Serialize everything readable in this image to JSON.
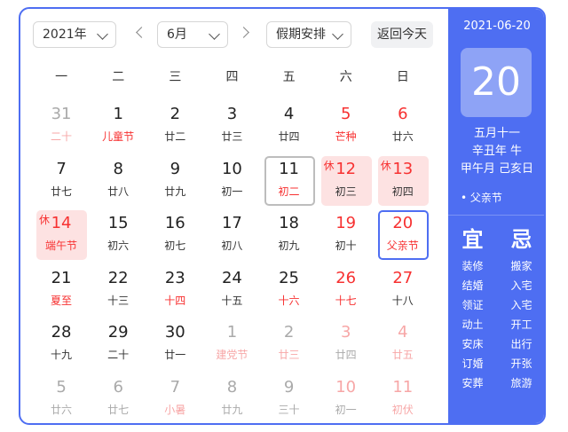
{
  "toolbar": {
    "year": "2021年",
    "month": "6月",
    "holiday_select": "假期安排",
    "today_button": "返回今天"
  },
  "weekdays": [
    "一",
    "二",
    "三",
    "四",
    "五",
    "六",
    "日"
  ],
  "days": [
    {
      "n": "31",
      "l": "二十",
      "other": true,
      "weekend": false,
      "redl": true
    },
    {
      "n": "1",
      "l": "儿童节",
      "redl": true
    },
    {
      "n": "2",
      "l": "廿二"
    },
    {
      "n": "3",
      "l": "廿三"
    },
    {
      "n": "4",
      "l": "廿四"
    },
    {
      "n": "5",
      "l": "芒种",
      "weekend": true,
      "redl": true
    },
    {
      "n": "6",
      "l": "廿六",
      "weekend": true
    },
    {
      "n": "7",
      "l": "廿七"
    },
    {
      "n": "8",
      "l": "廿八"
    },
    {
      "n": "9",
      "l": "廿九"
    },
    {
      "n": "10",
      "l": "初一"
    },
    {
      "n": "11",
      "l": "初二",
      "sel": true,
      "redl": true
    },
    {
      "n": "12",
      "l": "初三",
      "weekend": true,
      "holiday": true,
      "tag": "休"
    },
    {
      "n": "13",
      "l": "初四",
      "weekend": true,
      "holiday": true,
      "tag": "休"
    },
    {
      "n": "14",
      "l": "端午节",
      "holiday": true,
      "tag": "休",
      "redl": true,
      "weekend": true
    },
    {
      "n": "15",
      "l": "初六"
    },
    {
      "n": "16",
      "l": "初七"
    },
    {
      "n": "17",
      "l": "初八"
    },
    {
      "n": "18",
      "l": "初九"
    },
    {
      "n": "19",
      "l": "初十",
      "weekend": true
    },
    {
      "n": "20",
      "l": "父亲节",
      "weekend": true,
      "redl": true,
      "curr": true
    },
    {
      "n": "21",
      "l": "夏至",
      "redl": true
    },
    {
      "n": "22",
      "l": "十三"
    },
    {
      "n": "23",
      "l": "十四",
      "redl": true
    },
    {
      "n": "24",
      "l": "十五"
    },
    {
      "n": "25",
      "l": "十六",
      "redl": true
    },
    {
      "n": "26",
      "l": "十七",
      "weekend": true,
      "redl": true
    },
    {
      "n": "27",
      "l": "十八",
      "weekend": true
    },
    {
      "n": "28",
      "l": "十九"
    },
    {
      "n": "29",
      "l": "二十"
    },
    {
      "n": "30",
      "l": "廿一"
    },
    {
      "n": "1",
      "l": "建党节",
      "other": true,
      "redl": true
    },
    {
      "n": "2",
      "l": "廿三",
      "other": true,
      "redl": true
    },
    {
      "n": "3",
      "l": "廿四",
      "other": true,
      "weekend": true
    },
    {
      "n": "4",
      "l": "廿五",
      "other": true,
      "weekend": true,
      "redl": true
    },
    {
      "n": "5",
      "l": "廿六",
      "other": true
    },
    {
      "n": "6",
      "l": "廿七",
      "other": true
    },
    {
      "n": "7",
      "l": "小暑",
      "other": true,
      "redl": true
    },
    {
      "n": "8",
      "l": "廿九",
      "other": true
    },
    {
      "n": "9",
      "l": "三十",
      "other": true
    },
    {
      "n": "10",
      "l": "初一",
      "other": true,
      "weekend": true
    },
    {
      "n": "11",
      "l": "初伏",
      "other": true,
      "weekend": true,
      "redl": true
    }
  ],
  "panel": {
    "date": "2021-06-20",
    "day": "20",
    "lunar_date": "五月十一",
    "year_ganzhi": "辛丑年 牛",
    "month_day_ganzhi": "甲午月 己亥日",
    "festival": "• 父亲节",
    "yi_label": "宜",
    "ji_label": "忌",
    "yi": [
      "装修",
      "结婚",
      "领证",
      "动土",
      "安床",
      "订婚",
      "安葬"
    ],
    "ji": [
      "搬家",
      "入宅",
      "入宅",
      "开工",
      "出行",
      "开张",
      "旅游"
    ]
  },
  "colors": {
    "accent": "#4e6ef2",
    "holiday_bg": "#fde2e2",
    "red": "#f73131"
  }
}
